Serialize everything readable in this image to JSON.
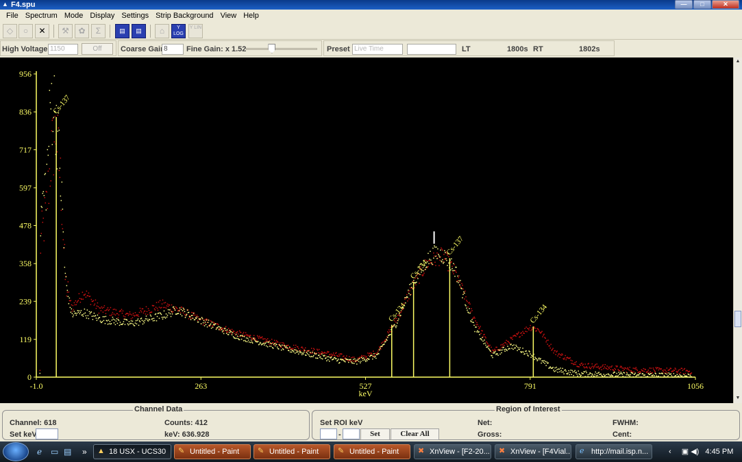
{
  "window": {
    "title": "F4.spu",
    "min": "—",
    "max": "□",
    "close": "✕"
  },
  "menu": [
    "File",
    "Spectrum",
    "Mode",
    "Display",
    "Settings",
    "Strip Background",
    "View",
    "Help"
  ],
  "toolbar": {
    "icons": [
      {
        "name": "move-icon",
        "glyph": "◇",
        "active": false
      },
      {
        "name": "circle-icon",
        "glyph": "○",
        "active": false
      },
      {
        "name": "close-x-icon",
        "glyph": "✕",
        "active": false,
        "dark": true
      },
      {
        "name": "wrench-icon",
        "glyph": "⚒",
        "active": false
      },
      {
        "name": "gear-icon",
        "glyph": "✿",
        "active": false
      },
      {
        "name": "sigma-icon",
        "glyph": "Σ",
        "active": false
      },
      {
        "name": "document-icon-1",
        "glyph": "▤",
        "active": true
      },
      {
        "name": "document-icon-2",
        "glyph": "▤",
        "active": true
      },
      {
        "name": "home-icon",
        "glyph": "⌂",
        "active": false
      },
      {
        "name": "y-log-icon",
        "glyph": "Y LOG",
        "active": true
      },
      {
        "name": "y-lin-icon",
        "glyph": "Y LIN",
        "active": false
      }
    ]
  },
  "controls": {
    "high_voltage_label": "High Voltage",
    "high_voltage_value": "1150",
    "off_button": "Off",
    "coarse_gain_label": "Coarse Gain",
    "coarse_gain_value": "8",
    "fine_gain_label": "Fine Gain: x 1.52",
    "fine_gain_fraction": 0.36,
    "preset_label": "Preset",
    "preset_value": "Live Time",
    "preset_input": "",
    "lt_label": "LT",
    "lt_value": "1800s",
    "rt_label": "RT",
    "rt_value": "1802s"
  },
  "chart_data": {
    "type": "scatter",
    "xlabel": "keV",
    "x_ticks": [
      "-1.0",
      "263",
      "527",
      "791",
      "1056"
    ],
    "y_ticks": [
      "0",
      "119",
      "239",
      "358",
      "478",
      "597",
      "717",
      "836",
      "956"
    ],
    "xlim": [
      -1.0,
      1056
    ],
    "ylim": [
      0,
      956
    ],
    "grid": false,
    "colors": {
      "axis": "#ffff66",
      "series_a": "#cc1111",
      "series_b": "#ffff88",
      "background": "#000000"
    },
    "peaks": [
      {
        "label": "Cs-137",
        "kev": 31,
        "height": 820
      },
      {
        "label": "Cs-134",
        "kev": 569,
        "height": 165
      },
      {
        "label": "Cs-134",
        "kev": 604,
        "height": 300
      },
      {
        "label": "Cs-137",
        "kev": 662,
        "height": 375
      },
      {
        "label": "Cs-134",
        "kev": 796,
        "height": 160
      }
    ],
    "cursor": {
      "kev": 636.928,
      "counts": 412
    },
    "series": [
      {
        "color": "red",
        "profile": [
          [
            5,
            420
          ],
          [
            15,
            540
          ],
          [
            22,
            700
          ],
          [
            30,
            780
          ],
          [
            38,
            600
          ],
          [
            45,
            300
          ],
          [
            55,
            220
          ],
          [
            75,
            270
          ],
          [
            100,
            215
          ],
          [
            150,
            195
          ],
          [
            200,
            230
          ],
          [
            225,
            215
          ],
          [
            263,
            180
          ],
          [
            320,
            140
          ],
          [
            400,
            100
          ],
          [
            480,
            70
          ],
          [
            510,
            55
          ],
          [
            545,
            80
          ],
          [
            575,
            180
          ],
          [
            600,
            280
          ],
          [
            625,
            360
          ],
          [
            650,
            385
          ],
          [
            670,
            330
          ],
          [
            700,
            190
          ],
          [
            730,
            80
          ],
          [
            760,
            120
          ],
          [
            790,
            160
          ],
          [
            805,
            150
          ],
          [
            830,
            80
          ],
          [
            870,
            40
          ],
          [
            950,
            25
          ],
          [
            1050,
            20
          ]
        ]
      },
      {
        "color": "yellow",
        "profile": [
          [
            5,
            500
          ],
          [
            15,
            640
          ],
          [
            22,
            880
          ],
          [
            30,
            840
          ],
          [
            38,
            600
          ],
          [
            45,
            300
          ],
          [
            55,
            200
          ],
          [
            75,
            205
          ],
          [
            100,
            185
          ],
          [
            150,
            170
          ],
          [
            200,
            195
          ],
          [
            225,
            215
          ],
          [
            263,
            180
          ],
          [
            320,
            130
          ],
          [
            400,
            90
          ],
          [
            480,
            55
          ],
          [
            510,
            50
          ],
          [
            545,
            70
          ],
          [
            575,
            170
          ],
          [
            600,
            290
          ],
          [
            625,
            370
          ],
          [
            640,
            395
          ],
          [
            655,
            380
          ],
          [
            670,
            340
          ],
          [
            700,
            160
          ],
          [
            730,
            70
          ],
          [
            760,
            100
          ],
          [
            790,
            75
          ],
          [
            805,
            55
          ],
          [
            830,
            25
          ],
          [
            870,
            12
          ],
          [
            950,
            8
          ],
          [
            1050,
            5
          ]
        ]
      }
    ]
  },
  "channel_data": {
    "title": "Channel Data",
    "channel": "Channel: 618",
    "counts": "Counts:  412",
    "set_kev": "Set keV",
    "kev": "keV:  636.928"
  },
  "roi": {
    "title": "Region of Interest",
    "set_roi": "Set ROI keV",
    "dash": "-",
    "set_button": "Set",
    "clear_button": "Clear All",
    "net": "Net:",
    "gross": "Gross:",
    "fwhm": "FWHM:",
    "cent": "Cent:"
  },
  "taskbar": {
    "items": [
      {
        "label": "18 USX - UCS30",
        "style": "active"
      },
      {
        "label": "Untitled - Paint",
        "style": "paint"
      },
      {
        "label": "Untitled - Paint",
        "style": "paint"
      },
      {
        "label": "Untitled - Paint",
        "style": "paint"
      },
      {
        "label": "XnView - [F2-20...",
        "style": "plain"
      },
      {
        "label": "XnView - [F4Vial...",
        "style": "plain"
      },
      {
        "label": "http://mail.isp.n...",
        "style": "plain"
      }
    ],
    "overflow": "»",
    "clock": "4:45 PM"
  }
}
